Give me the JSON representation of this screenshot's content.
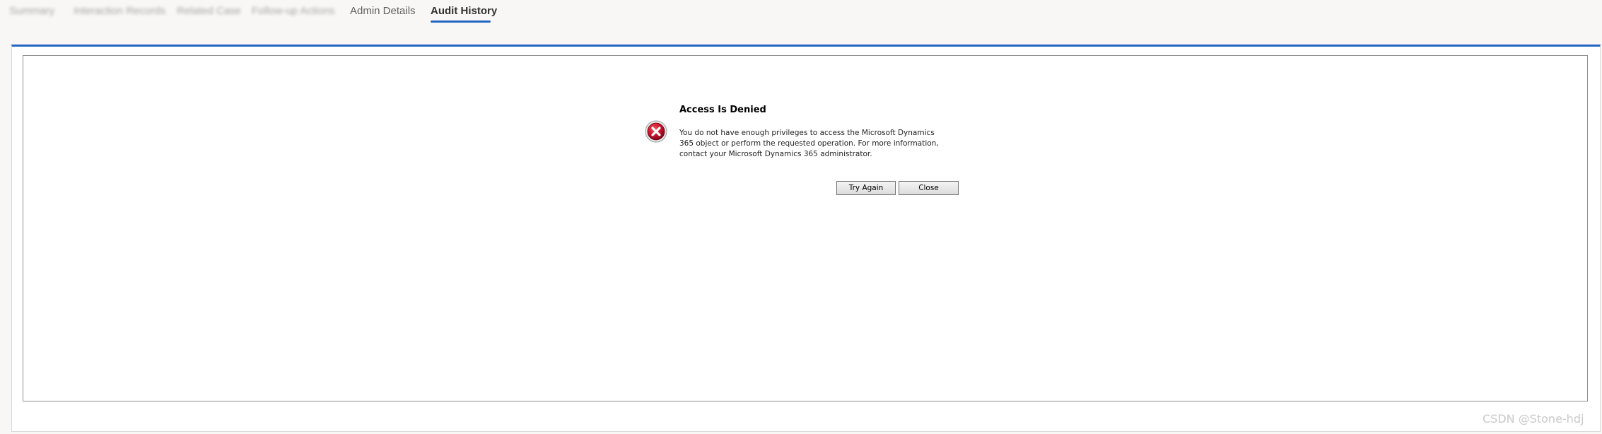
{
  "tabs": {
    "blurred": [
      {
        "label": "Summary"
      },
      {
        "label": "Interaction Records"
      },
      {
        "label": "Related Case"
      },
      {
        "label": "Follow-up Actions"
      }
    ],
    "admin_details": "Admin Details",
    "audit_history": "Audit History"
  },
  "dialog": {
    "icon": "error-x-icon",
    "title": "Access Is Denied",
    "message": "You do not have enough privileges to access the Microsoft Dynamics 365 object or perform the requested operation. For more information, contact your Microsoft Dynamics 365 administrator.",
    "try_again_label": "Try Again",
    "close_label": "Close"
  },
  "watermark": "CSDN @Stone-hdj",
  "colors": {
    "accent": "#2266c4",
    "error_red": "#c8102e",
    "background": "#f8f7f6"
  }
}
